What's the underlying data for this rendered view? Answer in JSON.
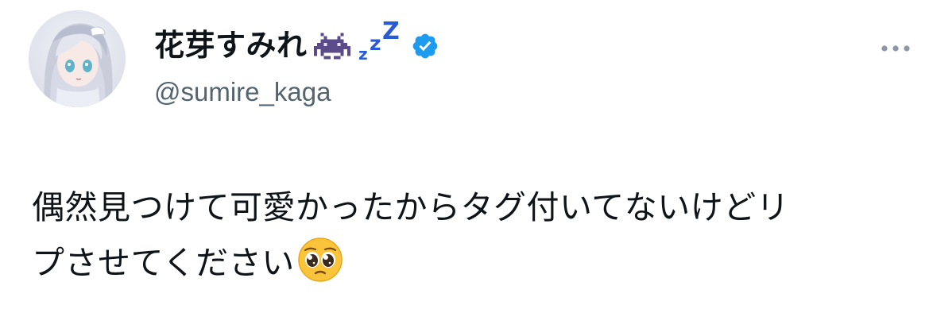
{
  "author": {
    "display_name": "花芽すみれ",
    "name_icons": [
      "alien-monster-icon",
      "zzz-icon",
      "verified-badge-icon"
    ],
    "zzz_text": "zzZ",
    "handle": "@sumire_kaga"
  },
  "post": {
    "text_line_1": "偶然見つけて可愛かったからタグ付いてないけどリ",
    "text_line_2": "プさせてください",
    "trailing_emoji": "pleading-face-icon"
  },
  "menu": {
    "icon": "more-options-icon"
  },
  "colors": {
    "text": "#0f1419",
    "secondary": "#536471",
    "verified": "#1d9bf0",
    "zzz": "#2a5bd7",
    "invader": "#5b4b8a"
  }
}
